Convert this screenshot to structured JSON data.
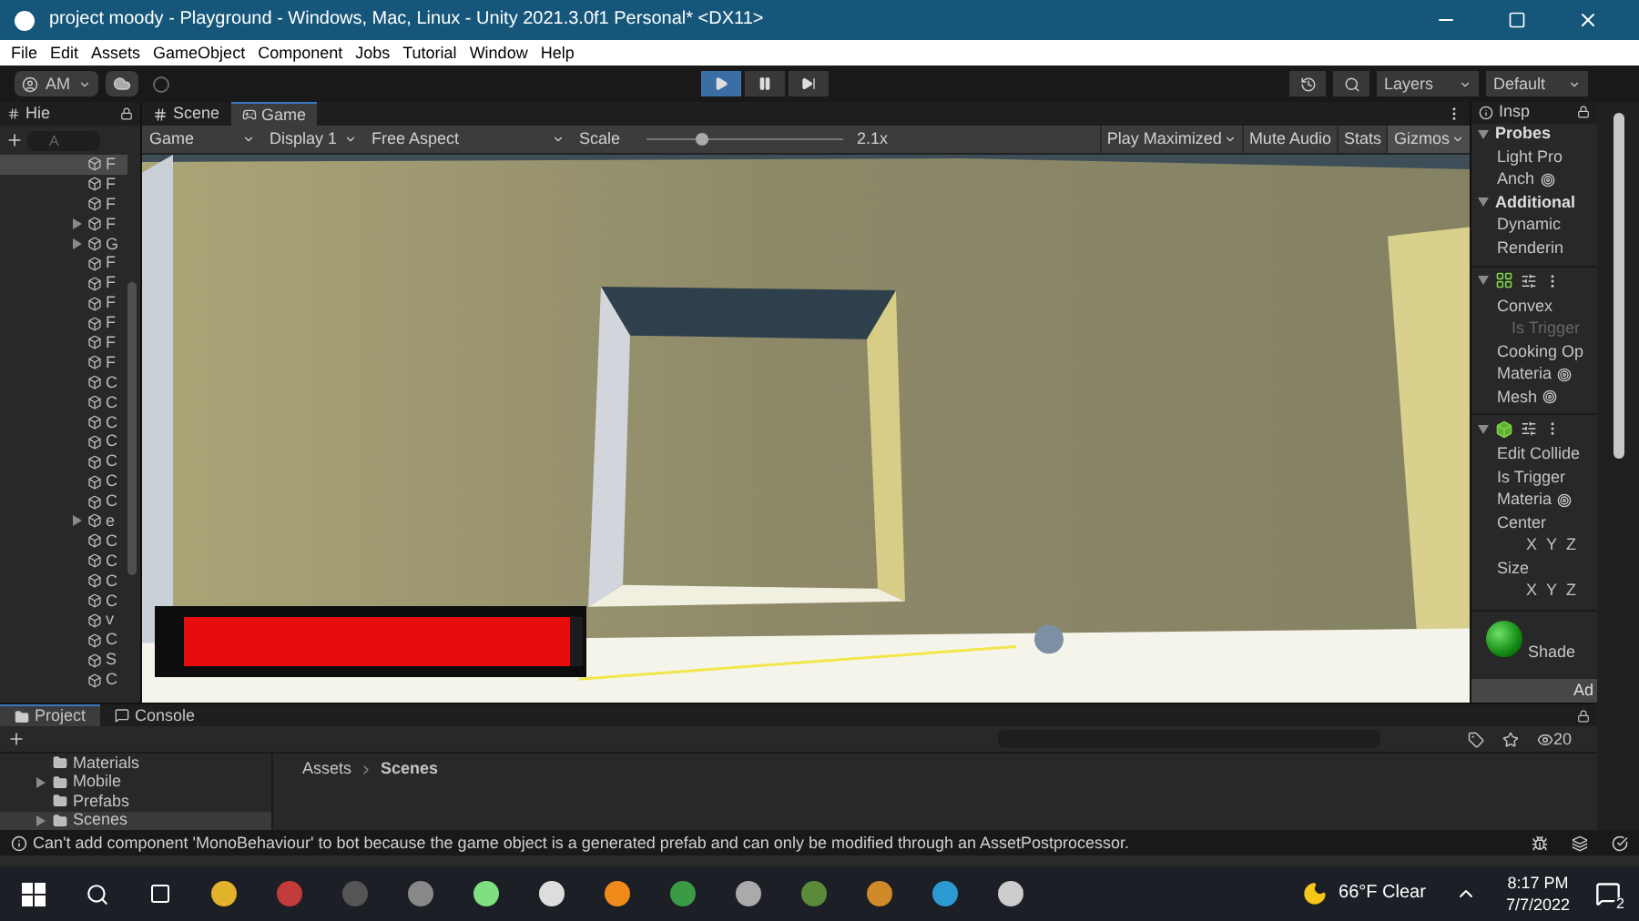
{
  "window": {
    "title": "project moody - Playground - Windows, Mac, Linux - Unity 2021.3.0f1 Personal* <DX11>"
  },
  "menu": [
    "File",
    "Edit",
    "Assets",
    "GameObject",
    "Component",
    "Jobs",
    "Tutorial",
    "Window",
    "Help"
  ],
  "toolbar": {
    "account": "AM",
    "play_controls": [
      {
        "kind": "play",
        "selected": true
      },
      {
        "kind": "pause",
        "selected": false
      },
      {
        "kind": "step",
        "selected": false
      }
    ],
    "layers": "Layers",
    "layout": "Default"
  },
  "hierarchy": {
    "title": "Hie",
    "search_placeholder": "A",
    "items": [
      {
        "label": "F",
        "kind": "item",
        "selected": true
      },
      {
        "label": "F",
        "kind": "item",
        "selected": false
      },
      {
        "label": "F",
        "kind": "item",
        "selected": false
      },
      {
        "label": "F",
        "kind": "group",
        "selected": false
      },
      {
        "label": "G",
        "kind": "group",
        "selected": false
      },
      {
        "label": "F",
        "kind": "item",
        "selected": false
      },
      {
        "label": "F",
        "kind": "item",
        "selected": false
      },
      {
        "label": "F",
        "kind": "item",
        "selected": false
      },
      {
        "label": "F",
        "kind": "item",
        "selected": false
      },
      {
        "label": "F",
        "kind": "item",
        "selected": false
      },
      {
        "label": "F",
        "kind": "item",
        "selected": false
      },
      {
        "label": "C",
        "kind": "item",
        "selected": false
      },
      {
        "label": "C",
        "kind": "item",
        "selected": false
      },
      {
        "label": "C",
        "kind": "item",
        "selected": false
      },
      {
        "label": "C",
        "kind": "item",
        "selected": false
      },
      {
        "label": "C",
        "kind": "item",
        "selected": false
      },
      {
        "label": "C",
        "kind": "item",
        "selected": false
      },
      {
        "label": "C",
        "kind": "item",
        "selected": false
      },
      {
        "label": "e",
        "kind": "group",
        "selected": false
      },
      {
        "label": "C",
        "kind": "item",
        "selected": false
      },
      {
        "label": "C",
        "kind": "item",
        "selected": false
      },
      {
        "label": "C",
        "kind": "item",
        "selected": false
      },
      {
        "label": "C",
        "kind": "item",
        "selected": false
      },
      {
        "label": "v",
        "kind": "item",
        "selected": false
      },
      {
        "label": "C",
        "kind": "item",
        "selected": false
      },
      {
        "label": "S",
        "kind": "item",
        "selected": false
      },
      {
        "label": "C",
        "kind": "item",
        "selected": false
      }
    ]
  },
  "view_tabs": [
    {
      "label": "Scene",
      "kind": "scene",
      "selected": false
    },
    {
      "label": "Game",
      "kind": "game",
      "selected": true
    }
  ],
  "game_toolbar": {
    "view": "Game",
    "display": "Display 1",
    "aspect": "Free Aspect",
    "scale": {
      "label": "Scale",
      "level": 0.28,
      "reading": "2.1x"
    },
    "toggles": [
      {
        "label": "Play Maximized",
        "kind": "dropdown",
        "selected": false
      },
      {
        "label": "Mute Audio",
        "kind": "toggle",
        "selected": false
      },
      {
        "label": "Stats",
        "kind": "toggle",
        "selected": false
      },
      {
        "label": "Gizmos",
        "kind": "dropdown",
        "selected": true
      }
    ]
  },
  "game_view": {
    "health_bar": {
      "level": 0.97
    }
  },
  "inspector": {
    "title": "Insp",
    "rows": [
      {
        "kind": "section",
        "label": "Probes"
      },
      {
        "kind": "property",
        "label": "Light Pro",
        "disabled": false
      },
      {
        "kind": "object_field",
        "label": "Anch",
        "disabled": false
      },
      {
        "kind": "section",
        "label": "Additional"
      },
      {
        "kind": "property",
        "label": "Dynamic",
        "disabled": false
      },
      {
        "kind": "property",
        "label": "Renderin",
        "disabled": false
      },
      {
        "kind": "component_grid"
      },
      {
        "kind": "property",
        "label": "Convex",
        "disabled": false
      },
      {
        "kind": "property",
        "label": "Is Trigger",
        "disabled": true
      },
      {
        "kind": "property",
        "label": "Cooking Op",
        "disabled": false
      },
      {
        "kind": "object_field",
        "label": "Materia",
        "disabled": false
      },
      {
        "kind": "object_field",
        "label": "Mesh",
        "disabled": false
      },
      {
        "kind": "component_cube"
      },
      {
        "kind": "property",
        "label": "Edit Collide",
        "disabled": false
      },
      {
        "kind": "property",
        "label": "Is Trigger",
        "disabled": false
      },
      {
        "kind": "object_field",
        "label": "Materia",
        "disabled": false
      },
      {
        "kind": "property",
        "label": "Center",
        "disabled": false
      },
      {
        "kind": "xyz",
        "axes": [
          "X",
          "Y",
          "Z"
        ]
      },
      {
        "kind": "property",
        "label": "Size",
        "disabled": false
      },
      {
        "kind": "xyz",
        "axes": [
          "X",
          "Y",
          "Z"
        ]
      },
      {
        "kind": "material",
        "label": "Shade"
      },
      {
        "kind": "button",
        "label": "Ad"
      }
    ]
  },
  "bottom_tabs": [
    {
      "label": "Project",
      "kind": "project",
      "selected": true
    },
    {
      "label": "Console",
      "kind": "console",
      "selected": false
    }
  ],
  "project": {
    "folders": [
      {
        "label": "Materials",
        "selected": false,
        "expandable": false
      },
      {
        "label": "Mobile",
        "selected": false,
        "expandable": true
      },
      {
        "label": "Prefabs",
        "selected": false,
        "expandable": false
      },
      {
        "label": "Scenes",
        "selected": true,
        "expandable": true
      }
    ],
    "breadcrumb": [
      "Assets",
      "Scenes"
    ],
    "hidden_count": "20"
  },
  "status_bar": {
    "message": "Can't add component 'MonoBehaviour' to bot because the game object is a generated prefab and can only be modified through an AssetPostprocessor."
  },
  "taskbar": {
    "weather": "66°F Clear",
    "time": "8:17 PM",
    "date": "7/7/2022",
    "notifications": "2"
  }
}
